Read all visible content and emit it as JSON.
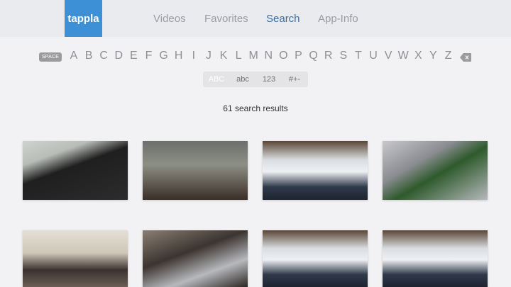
{
  "app": {
    "logo": "tappla"
  },
  "nav": {
    "items": [
      {
        "label": "Videos",
        "active": false
      },
      {
        "label": "Favorites",
        "active": false
      },
      {
        "label": "Search",
        "active": true
      },
      {
        "label": "App-Info",
        "active": false
      }
    ]
  },
  "keyboard": {
    "space_label": "SPACE",
    "letters": [
      "A",
      "B",
      "C",
      "D",
      "E",
      "F",
      "G",
      "H",
      "I",
      "J",
      "K",
      "L",
      "M",
      "N",
      "O",
      "P",
      "Q",
      "R",
      "S",
      "T",
      "U",
      "V",
      "W",
      "X",
      "Y",
      "Z"
    ],
    "backspace_icon": "backspace-icon",
    "modes": [
      {
        "label": "ABC",
        "selected": true
      },
      {
        "label": "abc",
        "selected": false
      },
      {
        "label": "123",
        "selected": false
      },
      {
        "label": "#+-",
        "selected": false
      }
    ]
  },
  "results": {
    "count_text": "61 search results",
    "thumbnails": [
      {
        "desc": "cooking pot on stove"
      },
      {
        "desc": "two men selfie"
      },
      {
        "desc": "sports arena"
      },
      {
        "desc": "food in foil"
      },
      {
        "desc": "man cooking in kitchen"
      },
      {
        "desc": "cooking closeup"
      },
      {
        "desc": "sports arena"
      },
      {
        "desc": "sports arena"
      }
    ]
  },
  "colors": {
    "logo_bg": "#3d8fd6",
    "nav_active": "#3a6e9e",
    "nav_inactive": "#9a9ca3"
  }
}
